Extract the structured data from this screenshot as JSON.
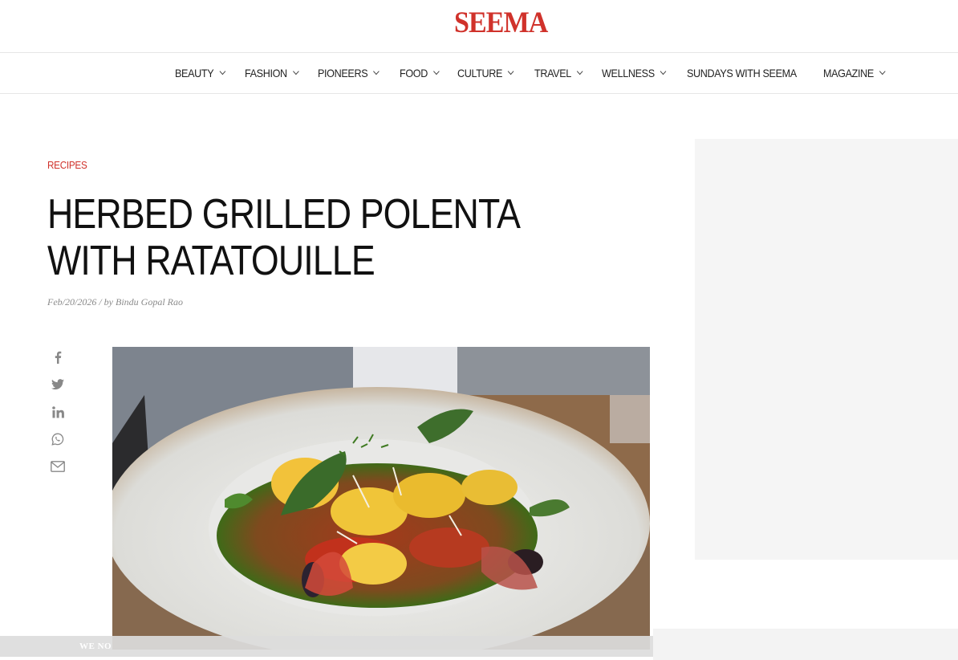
{
  "site": {
    "logo": "SEEMA",
    "brand_color": "#d0322b"
  },
  "nav": {
    "items": [
      {
        "label": "BEAUTY",
        "has_dropdown": true
      },
      {
        "label": "FASHION",
        "has_dropdown": true
      },
      {
        "label": "PIONEERS",
        "has_dropdown": true
      },
      {
        "label": "FOOD",
        "has_dropdown": true
      },
      {
        "label": "CULTURE",
        "has_dropdown": true
      },
      {
        "label": "TRAVEL",
        "has_dropdown": true
      },
      {
        "label": "WELLNESS",
        "has_dropdown": true
      },
      {
        "label": "SUNDAYS WITH SEEMA",
        "has_dropdown": false
      },
      {
        "label": "MAGAZINE",
        "has_dropdown": true
      }
    ]
  },
  "article": {
    "category": "RECIPES",
    "title": "HERBED GRILLED POLENTA WITH RATATOUILLE",
    "meta": "Feb/20/2026 / by Bindu Gopal Rao"
  },
  "share": {
    "icons": [
      "facebook-icon",
      "twitter-icon",
      "linkedin-icon",
      "whatsapp-icon",
      "email-icon"
    ]
  },
  "notice": {
    "text": "WE NO"
  }
}
